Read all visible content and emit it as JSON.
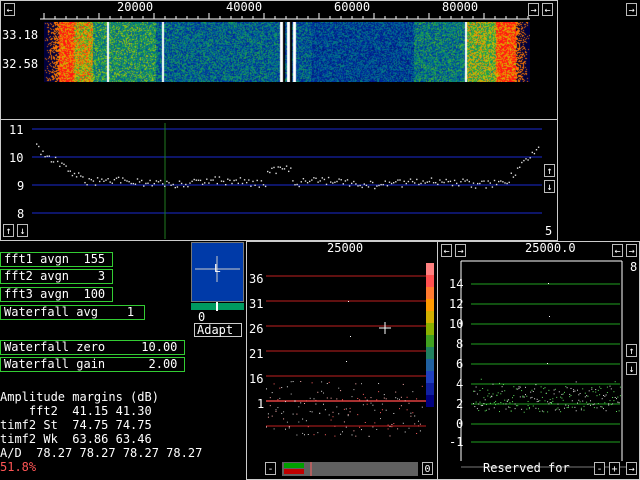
{
  "waterfall": {
    "freq_ticks": [
      "20000",
      "40000",
      "60000",
      "80000"
    ],
    "time_labels": [
      "33.18",
      "32.58"
    ]
  },
  "spectrum": {
    "y_ticks": [
      "11",
      "10",
      "9",
      "8"
    ],
    "right_value": "5"
  },
  "params": {
    "fft1_avgn": "fft1 avgn  155",
    "fft2_avgn": "fft2 avgn    3",
    "fft3_avgn": "fft3 avgn  100",
    "waterfall_avg": "Waterfall avg    1",
    "waterfall_zero": "Waterfall zero     10.00",
    "waterfall_gain": "Waterfall gain      2.00"
  },
  "meter": {
    "marker": "L",
    "value": "0",
    "adapt_label": "Adapt"
  },
  "amplitude": {
    "title": "Amplitude margins (dB)",
    "rows": [
      "    fft2  41.15 41.30",
      "timf2 St  74.75 74.75",
      "timf2 Wk  63.86 63.46",
      "A/D  78.27 78.27 78.27 78.27"
    ],
    "percent": "51.8%",
    "percent_color": "#ff5555"
  },
  "baseband": {
    "freq": "25000",
    "y_ticks": [
      "36",
      "31",
      "26",
      "21",
      "16",
      "1"
    ]
  },
  "hires": {
    "freq": "25000.0",
    "y_ticks": [
      "14",
      "12",
      "10",
      "8",
      "6",
      "4",
      "2",
      "0",
      "-1"
    ],
    "right_value": "8",
    "footer": "Reserved for"
  },
  "buttons": {
    "left": "←",
    "right": "→",
    "up": "↑",
    "down": "↓",
    "minus": "-",
    "plus": "+",
    "zero": "0"
  }
}
